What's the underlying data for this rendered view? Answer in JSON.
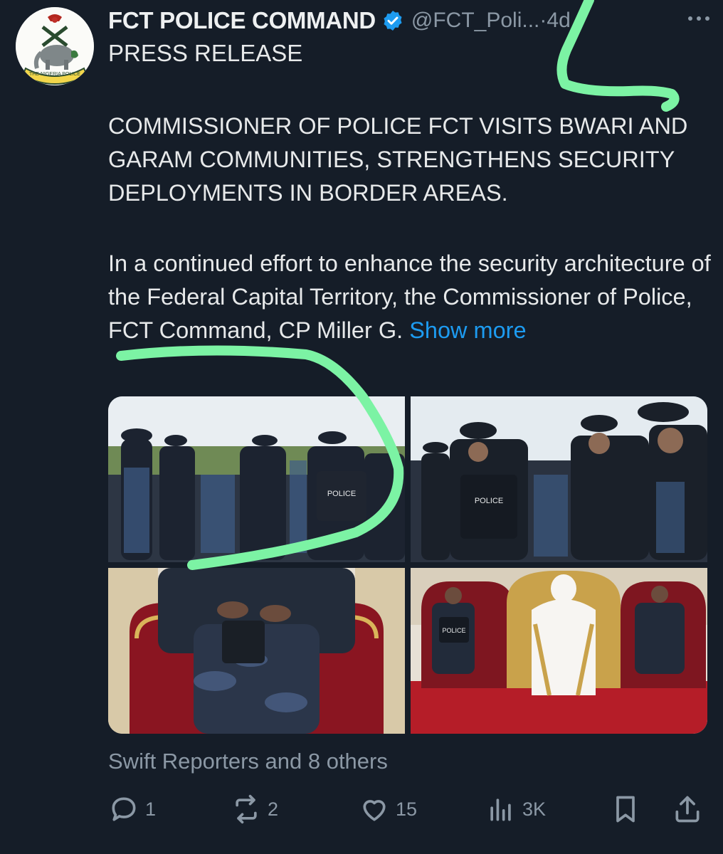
{
  "tweet": {
    "display_name": "FCT POLICE COMMAND",
    "handle": "@FCT_Poli...",
    "time_separator": " · ",
    "time": "4d",
    "headline": "PRESS RELEASE",
    "paragraph1": "COMMISSIONER OF POLICE FCT VISITS BWARI AND GARAM COMMUNITIES, STRENGTHENS SECURITY DEPLOYMENTS IN BORDER AREAS.",
    "paragraph2": "In a continued effort to enhance the security architecture of the Federal Capital Territory, the Commissioner of Police, FCT Command, CP Miller G.",
    "show_more": "Show more",
    "liked_by": "Swift Reporters and 8 others",
    "photos": [
      {
        "badge": "POLICE"
      },
      {
        "badge": "POLICE"
      },
      {
        "badge": ""
      },
      {
        "badge": "POLICE"
      }
    ],
    "avatar": {
      "seal_text": "THE NIGERIA POLICE"
    }
  },
  "actions": {
    "replies": "1",
    "reposts": "2",
    "likes": "15",
    "views": "3K"
  },
  "icons": {
    "verified": "verified-badge-icon",
    "more": "more-options-icon",
    "reply": "reply-icon",
    "repost": "repost-icon",
    "like": "like-icon",
    "views": "views-icon",
    "bookmark": "bookmark-icon",
    "share": "share-icon"
  },
  "colors": {
    "background": "#151d28",
    "text": "#e7e9ea",
    "muted": "#8b98a5",
    "link": "#1d9bf0",
    "scribble": "#7cf3a4"
  }
}
